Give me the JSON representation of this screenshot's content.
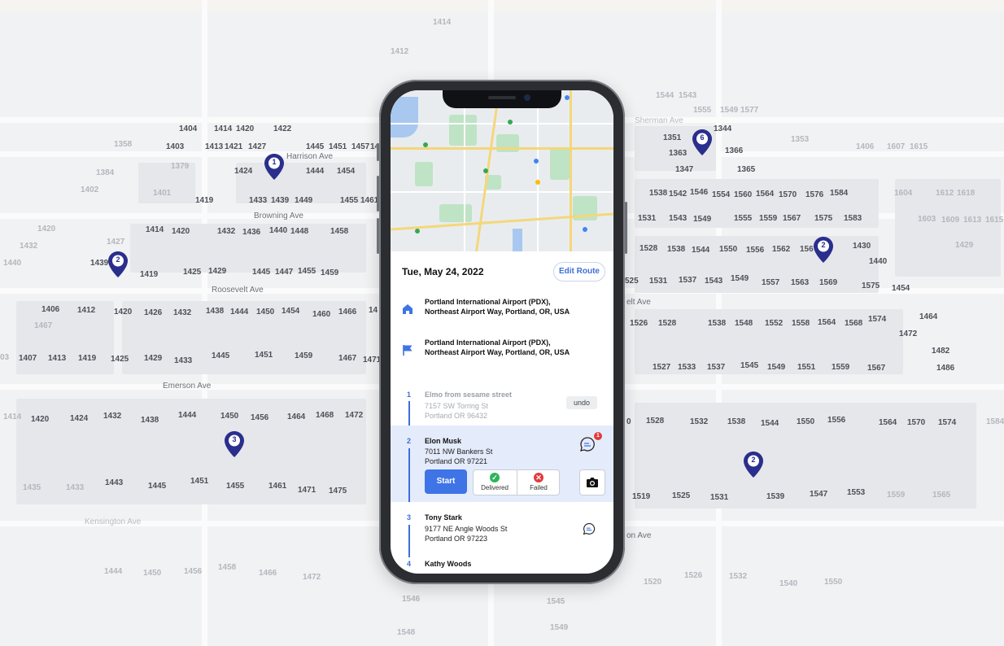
{
  "background_map": {
    "streets": [
      "Harrison Ave",
      "Browning Ave",
      "Roosevelt Ave",
      "Emerson Ave",
      "Kensington Ave",
      "Sherman Ave",
      "elt Ave",
      "on Ave"
    ],
    "pins": [
      "1",
      "2",
      "3",
      "6",
      "2",
      "2"
    ],
    "house_numbers": [
      "1404",
      "1414",
      "1420",
      "1422",
      "1403",
      "1413",
      "1421",
      "1427",
      "1445",
      "1451",
      "1457",
      "14",
      "1424",
      "1444",
      "1454",
      "1419",
      "1433",
      "1439",
      "1449",
      "1455",
      "1461",
      "1401",
      "1402",
      "1384",
      "1379",
      "1358",
      "1414",
      "1420",
      "1432",
      "1436",
      "1440",
      "1448",
      "1458",
      "1420",
      "1427",
      "1432",
      "1440",
      "1419",
      "1425",
      "1429",
      "1445",
      "1447",
      "1455",
      "1459",
      "1439",
      "1406",
      "1412",
      "1420",
      "1426",
      "1432",
      "1438",
      "1444",
      "1450",
      "1454",
      "1460",
      "1466",
      "14",
      "1467",
      "03",
      "1407",
      "1413",
      "1419",
      "1425",
      "1429",
      "1433",
      "1445",
      "1451",
      "1459",
      "1467",
      "1471",
      "1414",
      "1420",
      "1424",
      "1432",
      "1438",
      "1444",
      "1450",
      "1456",
      "1464",
      "1468",
      "1472",
      "1435",
      "1433",
      "1443",
      "1445",
      "1451",
      "1455",
      "1461",
      "1471",
      "1475",
      "1444",
      "1450",
      "1456",
      "1458",
      "1466",
      "1472",
      "1546",
      "1545",
      "1549",
      "1548",
      "1544",
      "1543",
      "1555",
      "1549",
      "1577",
      "1351",
      "1363",
      "1344",
      "1366",
      "1347",
      "1365",
      "1353",
      "1538",
      "1542",
      "1546",
      "1554",
      "1560",
      "1564",
      "1570",
      "1576",
      "1584",
      "1604",
      "1612",
      "1618",
      "1531",
      "1543",
      "1549",
      "1555",
      "1559",
      "1567",
      "1575",
      "1583",
      "1603",
      "1609",
      "1613",
      "1615",
      "1528",
      "1538",
      "1544",
      "1550",
      "1556",
      "1562",
      "156",
      "1430",
      "1440",
      "1429",
      "525",
      "1531",
      "1537",
      "1543",
      "1549",
      "1557",
      "1563",
      "1569",
      "1575",
      "1454",
      "1526",
      "1528",
      "1538",
      "1548",
      "1552",
      "1558",
      "1564",
      "1568",
      "1574",
      "1464",
      "1472",
      "1527",
      "1533",
      "1537",
      "1545",
      "1549",
      "1551",
      "1559",
      "1567",
      "1482",
      "1486",
      "0",
      "1528",
      "1532",
      "1538",
      "1544",
      "1550",
      "1556",
      "1564",
      "1570",
      "1574",
      "1584",
      "1519",
      "1525",
      "1531",
      "1539",
      "1547",
      "1553",
      "1559",
      "1565",
      "1520",
      "1526",
      "1532",
      "1540",
      "1550",
      "1607",
      "1615",
      "1406",
      "1412",
      "1414"
    ]
  },
  "app": {
    "date": "Tue, May 24, 2022",
    "edit_route_label": "Edit Route",
    "start_location": "Portland International Airport (PDX), Northeast Airport Way, Portland, OR, USA",
    "end_location": "Portland International Airport (PDX), Northeast Airport Way, Portland, OR, USA",
    "accent_color": "#3f74e6",
    "stops": [
      {
        "index": "1",
        "name": "Elmo from sesame street",
        "address_line1": "7157 SW Torring St",
        "address_line2": "Portland OR 96432",
        "status": "completed",
        "action": "undo"
      },
      {
        "index": "2",
        "name": "Elon Musk",
        "address_line1": "7011 NW Bankers St",
        "address_line2": "Portland OR 97221",
        "status": "active",
        "message_badge": "1"
      },
      {
        "index": "3",
        "name": "Tony Stark",
        "address_line1": "9177 NE Angle Woods St",
        "address_line2": "Portland OR 97223",
        "status": "pending"
      },
      {
        "index": "4",
        "name": "Kathy Woods",
        "status": "pending"
      }
    ],
    "actions": {
      "start_label": "Start",
      "delivered_label": "Delivered",
      "failed_label": "Failed"
    },
    "icons": [
      "home-icon",
      "flag-icon",
      "chat-icon",
      "camera-icon",
      "check-icon",
      "x-icon",
      "map-pin-icon"
    ]
  }
}
